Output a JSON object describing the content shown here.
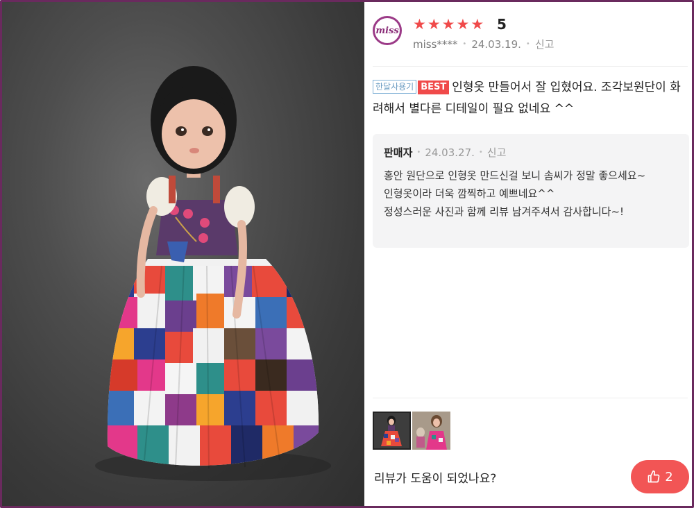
{
  "review": {
    "avatar_text": "miss",
    "rating_stars": 5,
    "rating_value": "5",
    "username": "miss****",
    "date": "24.03.19.",
    "report_label": "신고",
    "badge_month": "한달사용기",
    "badge_best": "BEST",
    "text": "인형옷 만들어서 잘 입혔어요. 조각보원단이 화려해서 별다른 디테일이 필요 없네요 ^^"
  },
  "seller_reply": {
    "author": "판매자",
    "date": "24.03.27.",
    "report_label": "신고",
    "lines": [
      "홍안 원단으로 인형옷 만드신걸 보니 솜씨가 정말 좋으세요~",
      "인형옷이라 더욱 깜찍하고 예쁘네요^^",
      "정성스러운 사진과 함께 리뷰 남겨주셔서 감사합니다~!"
    ]
  },
  "helpful": {
    "question": "리뷰가 도움이 되었나요?",
    "count": "2"
  },
  "colors": {
    "accent_red": "#f04a4a",
    "avatar_border": "#9b3a87",
    "frame": "#6a2a5e"
  },
  "icons": {
    "star": "star-icon",
    "thumbs_up": "thumbs-up-icon"
  }
}
